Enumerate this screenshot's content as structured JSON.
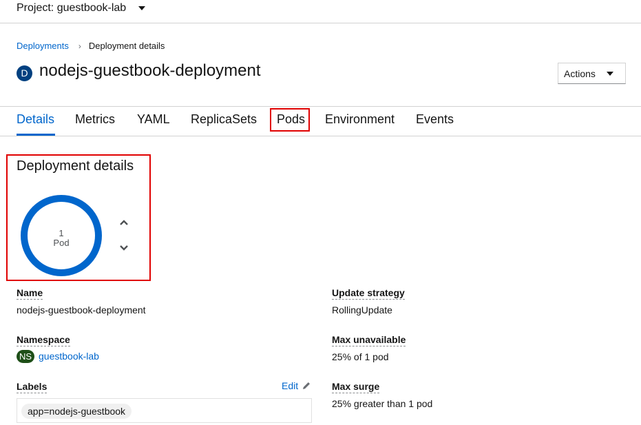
{
  "project": {
    "label": "Project: guestbook-lab"
  },
  "breadcrumb": {
    "parent": "Deployments",
    "separator": "›",
    "current": "Deployment details"
  },
  "header": {
    "badge": "D",
    "title": "nodejs-guestbook-deployment",
    "actions_label": "Actions"
  },
  "tabs": [
    {
      "label": "Details",
      "active": true
    },
    {
      "label": "Metrics"
    },
    {
      "label": "YAML"
    },
    {
      "label": "ReplicaSets"
    },
    {
      "label": "Pods"
    },
    {
      "label": "Environment"
    },
    {
      "label": "Events"
    }
  ],
  "section": {
    "title": "Deployment details"
  },
  "pod_donut": {
    "count": "1",
    "unit": "Pod",
    "color": "#0066cc"
  },
  "details": {
    "name": {
      "label": "Name",
      "value": "nodejs-guestbook-deployment"
    },
    "namespace": {
      "label": "Namespace",
      "badge": "NS",
      "value": "guestbook-lab"
    },
    "labels": {
      "label": "Labels",
      "edit": "Edit",
      "chips": [
        "app=nodejs-guestbook"
      ]
    },
    "update_strategy": {
      "label": "Update strategy",
      "value": "RollingUpdate"
    },
    "max_unavailable": {
      "label": "Max unavailable",
      "value": "25% of 1 pod"
    },
    "max_surge": {
      "label": "Max surge",
      "value": "25% greater than 1 pod"
    }
  },
  "colors": {
    "link": "#0066cc",
    "highlight": "#e00000",
    "ns_badge": "#1e4f18",
    "title_badge": "#004080"
  },
  "icons": [
    "caret-down-icon",
    "chevron-up-icon",
    "chevron-down-icon",
    "pencil-icon"
  ]
}
